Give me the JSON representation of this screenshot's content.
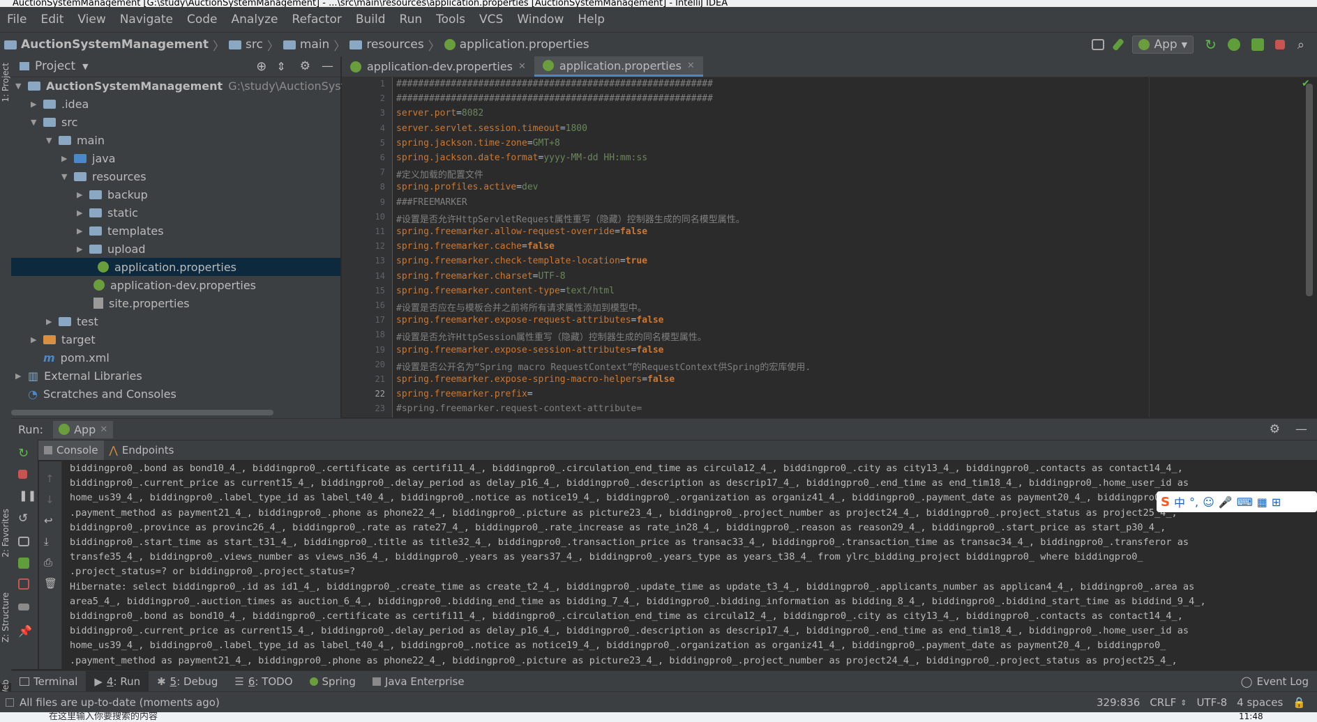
{
  "window": {
    "title": "AuctionSystemManagement [G:\\study\\AuctionSystemManagement] - ...\\src\\main\\resources\\application.properties [AuctionSystemManagement] - IntelliJ IDEA"
  },
  "menu": [
    "File",
    "Edit",
    "View",
    "Navigate",
    "Code",
    "Analyze",
    "Refactor",
    "Build",
    "Run",
    "Tools",
    "VCS",
    "Window",
    "Help"
  ],
  "breadcrumb": [
    "AuctionSystemManagement",
    "src",
    "main",
    "resources",
    "application.properties"
  ],
  "toolbar": {
    "run_config": "App"
  },
  "side_labels": {
    "project": "1: Project",
    "favorites": "2: Favorites",
    "structure": "Z: Structure",
    "web": "Web"
  },
  "project": {
    "header": "Project",
    "root_name": "AuctionSystemManagement",
    "root_path": "G:\\study\\AuctionSystemMa",
    "items": [
      ".idea",
      "src",
      "main",
      "java",
      "resources",
      "backup",
      "static",
      "templates",
      "upload",
      "application.properties",
      "application-dev.properties",
      "site.properties",
      "test",
      "target",
      "pom.xml",
      "External Libraries",
      "Scratches and Consoles"
    ]
  },
  "editor": {
    "tabs": [
      "application-dev.properties",
      "application.properties"
    ],
    "line_numbers": [
      "1",
      "2",
      "3",
      "4",
      "5",
      "6",
      "7",
      "8",
      "9",
      "10",
      "11",
      "12",
      "13",
      "14",
      "15",
      "16",
      "17",
      "18",
      "19",
      "20",
      "21",
      "22",
      "23"
    ],
    "lines": [
      {
        "k": "",
        "e": "",
        "v": "",
        "c": "##########################################################"
      },
      {
        "k": "",
        "e": "",
        "v": "",
        "c": "##########################################################"
      },
      {
        "k": "server.port",
        "e": "=",
        "v": "8082",
        "c": ""
      },
      {
        "k": "server.servlet.session.timeout",
        "e": "=",
        "v": "1800",
        "c": ""
      },
      {
        "k": "spring.jackson.time-zone",
        "e": "=",
        "v": "GMT+8",
        "c": ""
      },
      {
        "k": "spring.jackson.date-format",
        "e": "=",
        "v": "yyyy-MM-dd HH:mm:ss",
        "c": ""
      },
      {
        "k": "",
        "e": "",
        "v": "",
        "c": "#定义加载的配置文件"
      },
      {
        "k": "spring.profiles.active",
        "e": "=",
        "v": "dev",
        "c": ""
      },
      {
        "k": "",
        "e": "",
        "v": "",
        "c": "###FREEMARKER"
      },
      {
        "k": "",
        "e": "",
        "v": "",
        "c": "#设置是否允许HttpServletRequest属性重写（隐藏）控制器生成的同名模型属性。"
      },
      {
        "k": "spring.freemarker.allow-request-override",
        "e": "=",
        "v": "false",
        "c": ""
      },
      {
        "k": "spring.freemarker.cache",
        "e": "=",
        "v": "false",
        "c": ""
      },
      {
        "k": "spring.freemarker.check-template-location",
        "e": "=",
        "v": "true",
        "c": ""
      },
      {
        "k": "spring.freemarker.charset",
        "e": "=",
        "v": "UTF-8",
        "c": ""
      },
      {
        "k": "spring.freemarker.content-type",
        "e": "=",
        "v": "text/html",
        "c": ""
      },
      {
        "k": "",
        "e": "",
        "v": "",
        "c": "#设置是否应在与模板合并之前将所有请求属性添加到模型中。"
      },
      {
        "k": "spring.freemarker.expose-request-attributes",
        "e": "=",
        "v": "false",
        "c": ""
      },
      {
        "k": "",
        "e": "",
        "v": "",
        "c": "#设置是否允许HttpSession属性重写（隐藏）控制器生成的同名模型属性。"
      },
      {
        "k": "spring.freemarker.expose-session-attributes",
        "e": "=",
        "v": "false",
        "c": ""
      },
      {
        "k": "",
        "e": "",
        "v": "",
        "c": "#设置是否公开名为“Spring macro RequestContext”的RequestContext供Spring的宏库使用."
      },
      {
        "k": "spring.freemarker.expose-spring-macro-helpers",
        "e": "=",
        "v": "false",
        "c": ""
      },
      {
        "k": "spring.freemarker.prefix",
        "e": "=",
        "v": "",
        "c": ""
      },
      {
        "k": "",
        "e": "",
        "v": "",
        "c": "#spring.freemarker.request-context-attribute="
      }
    ]
  },
  "run": {
    "label": "Run:",
    "config": "App",
    "subtabs": [
      "Console",
      "Endpoints"
    ],
    "console": [
      "  biddingpro0_.bond as bond10_4_, biddingpro0_.certificate as certifi11_4_, biddingpro0_.circulation_end_time as circula12_4_, biddingpro0_.city as city13_4_, biddingpro0_.contacts as contact14_4_,",
      " biddingpro0_.current_price as current15_4_, biddingpro0_.delay_period as delay_p16_4_, biddingpro0_.description as descrip17_4_, biddingpro0_.end_time as end_tim18_4_, biddingpro0_.home_user_id as",
      " home_us39_4_, biddingpro0_.label_type_id as label_t40_4_, biddingpro0_.notice as notice19_4_, biddingpro0_.organization as organiz41_4_, biddingpro0_.payment_date as payment20_4_, biddingpro0_",
      " .payment_method as payment21_4_, biddingpro0_.phone as phone22_4_, biddingpro0_.picture as picture23_4_, biddingpro0_.project_number as project24_4_, biddingpro0_.project_status as project25_4_,",
      " biddingpro0_.province as provinc26_4_, biddingpro0_.rate as rate27_4_, biddingpro0_.rate_increase as rate_in28_4_, biddingpro0_.reason as reason29_4_, biddingpro0_.start_price as start_p30_4_,",
      " biddingpro0_.start_time as start_t31_4_, biddingpro0_.title as title32_4_, biddingpro0_.transaction_price as transac33_4_, biddingpro0_.transaction_time as transac34_4_, biddingpro0_.transferor as",
      " transfe35_4_, biddingpro0_.views_number as views_n36_4_, biddingpro0_.years as years37_4_, biddingpro0_.years_type as years_t38_4_ from ylrc_bidding_project biddingpro0_ where biddingpro0_",
      " .project_status=? or biddingpro0_.project_status=?",
      "Hibernate: select biddingpro0_.id as id1_4_, biddingpro0_.create_time as create_t2_4_, biddingpro0_.update_time as update_t3_4_, biddingpro0_.applicants_number as applican4_4_, biddingpro0_.area as",
      " area5_4_, biddingpro0_.auction_times as auction_6_4_, biddingpro0_.bidding_end_time as bidding_7_4_, biddingpro0_.bidding_information as bidding_8_4_, biddingpro0_.biddind_start_time as biddind_9_4_,",
      "  biddingpro0_.bond as bond10_4_, biddingpro0_.certificate as certifi11_4_, biddingpro0_.circulation_end_time as circula12_4_, biddingpro0_.city as city13_4_, biddingpro0_.contacts as contact14_4_,",
      " biddingpro0_.current_price as current15_4_, biddingpro0_.delay_period as delay_p16_4_, biddingpro0_.description as descrip17_4_, biddingpro0_.end_time as end_tim18_4_, biddingpro0_.home_user_id as",
      " home_us39_4_, biddingpro0_.label_type_id as label_t40_4_, biddingpro0_.notice as notice19_4_, biddingpro0_.organization as organiz41_4_, biddingpro0_.payment_date as payment20_4_, biddingpro0_",
      " .payment_method as payment21_4_, biddingpro0_.phone as phone22_4_, biddingpro0_.picture as picture23_4_, biddingpro0_.project_number as project24_4_, biddingpro0_.project_status as project25_4_,"
    ]
  },
  "bottom_tabs": [
    {
      "key": "",
      "label": "Terminal"
    },
    {
      "key": "4",
      "label": ": Run"
    },
    {
      "key": "5",
      "label": ": Debug"
    },
    {
      "key": "6",
      "label": ": TODO"
    },
    {
      "key": "",
      "label": "Spring"
    },
    {
      "key": "",
      "label": "Java Enterprise"
    }
  ],
  "event_log": "Event Log",
  "status": {
    "message": "All files are up-to-date (moments ago)",
    "position": "329:836",
    "line_sep": "CRLF",
    "encoding": "UTF-8",
    "indent": "4 spaces"
  },
  "ime": {
    "label": "中"
  },
  "taskbar": {
    "search_placeholder": "在这里输入你要搜索的内容",
    "clock": "11:48"
  },
  "colors": {
    "accent": "#4a88c7",
    "selection": "#0d293e",
    "key": "#cc7832",
    "value": "#6a8759",
    "comment": "#808080"
  }
}
